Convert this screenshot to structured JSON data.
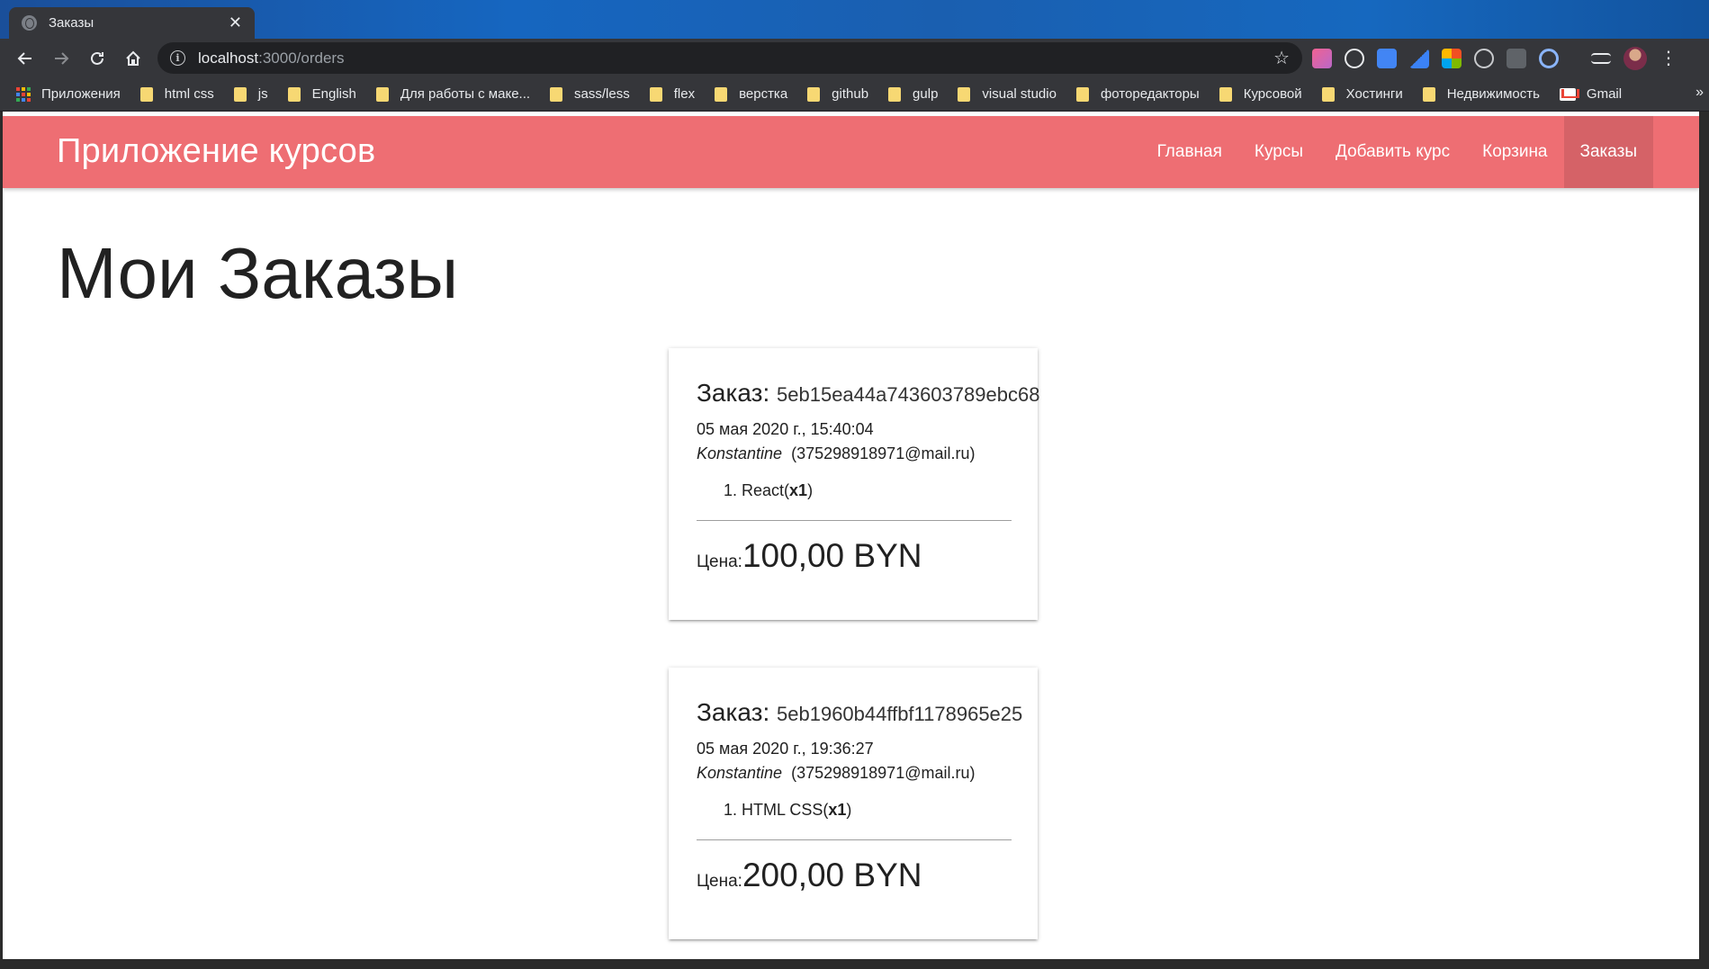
{
  "browser": {
    "tab_title": "Заказы",
    "tab_close": "✕",
    "url_host": "localhost",
    "url_path": ":3000/orders",
    "bookmarks": [
      {
        "label": "Приложения",
        "icon": "apps-icon"
      },
      {
        "label": "html css",
        "icon": "folder-icon"
      },
      {
        "label": "js",
        "icon": "folder-icon"
      },
      {
        "label": "English",
        "icon": "folder-icon"
      },
      {
        "label": "Для работы с маке...",
        "icon": "folder-icon"
      },
      {
        "label": "sass/less",
        "icon": "folder-icon"
      },
      {
        "label": "flex",
        "icon": "folder-icon"
      },
      {
        "label": "верстка",
        "icon": "folder-icon"
      },
      {
        "label": "github",
        "icon": "folder-icon"
      },
      {
        "label": "gulp",
        "icon": "folder-icon"
      },
      {
        "label": "visual studio",
        "icon": "folder-icon"
      },
      {
        "label": "фоторедакторы",
        "icon": "folder-icon"
      },
      {
        "label": "Курсовой",
        "icon": "folder-icon"
      },
      {
        "label": "Хостинги",
        "icon": "folder-icon"
      },
      {
        "label": "Недвижимость",
        "icon": "folder-icon"
      },
      {
        "label": "Gmail",
        "icon": "gmail-icon"
      }
    ],
    "bookmarks_more": "»"
  },
  "navbar": {
    "brand": "Приложение курсов",
    "links": [
      "Главная",
      "Курсы",
      "Добавить курс",
      "Корзина",
      "Заказы"
    ],
    "active_link": "Заказы",
    "color": "#ee6e73"
  },
  "page": {
    "title": "Мои Заказы"
  },
  "orders": [
    {
      "label": "Заказ:",
      "id": "5eb15ea44a743603789ebc68",
      "date": "05 мая 2020 г., 15:40:04",
      "name": "Konstantine",
      "email": "(375298918971@mail.ru)",
      "items": [
        {
          "title": "React",
          "qty": "x1"
        }
      ],
      "price_label": "Цена:",
      "price": "100,00 BYN"
    },
    {
      "label": "Заказ:",
      "id": "5eb1960b44ffbf1178965e25",
      "date": "05 мая 2020 г., 19:36:27",
      "name": "Konstantine",
      "email": "(375298918971@mail.ru)",
      "items": [
        {
          "title": "HTML CSS",
          "qty": "x1"
        }
      ],
      "price_label": "Цена:",
      "price": "200,00 BYN"
    }
  ]
}
